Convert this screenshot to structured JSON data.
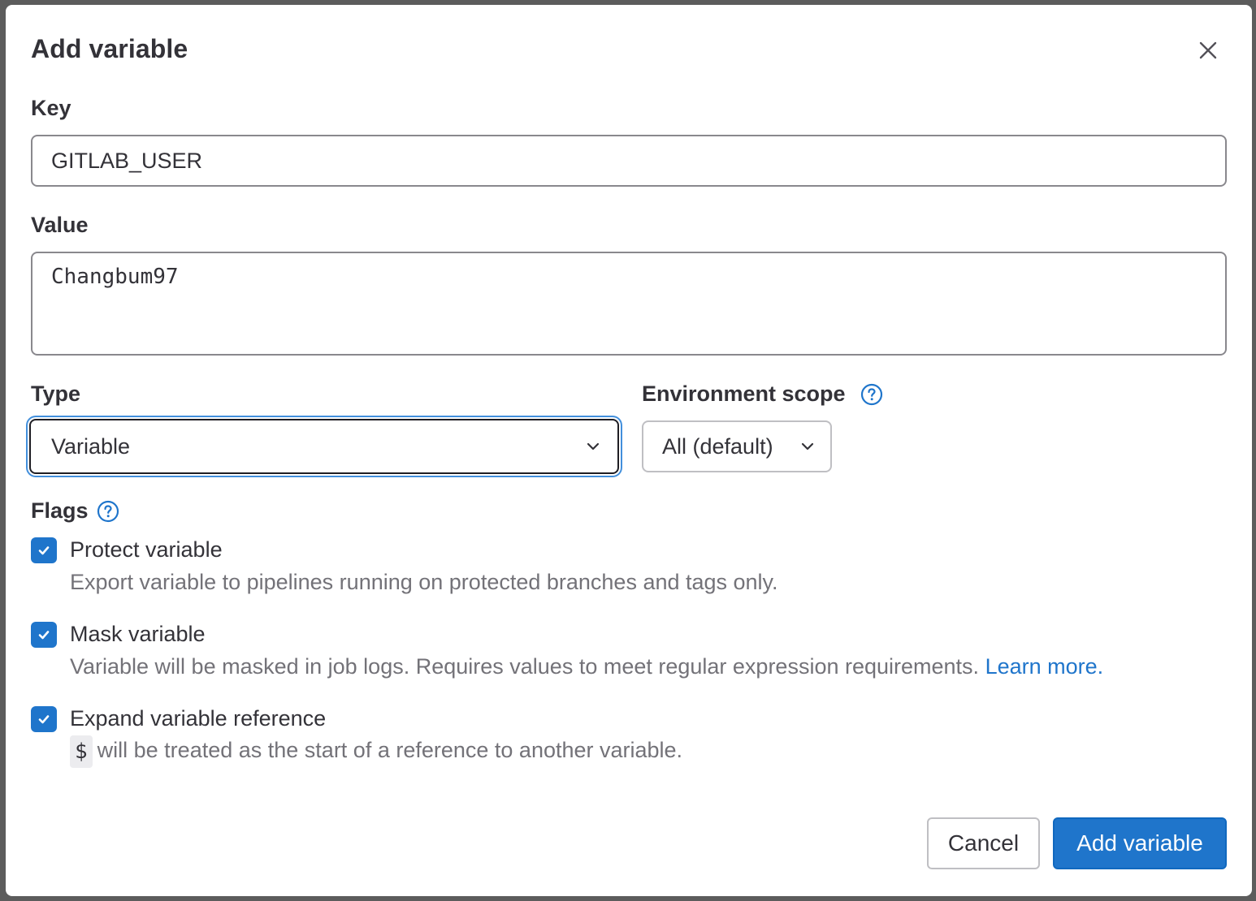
{
  "modal": {
    "title": "Add variable",
    "close_icon": "close-icon"
  },
  "key": {
    "label": "Key",
    "value": "GITLAB_USER"
  },
  "value": {
    "label": "Value",
    "value": "Changbum97"
  },
  "type": {
    "label": "Type",
    "selected": "Variable"
  },
  "environment_scope": {
    "label": "Environment scope",
    "selected": "All (default)"
  },
  "flags": {
    "label": "Flags",
    "items": [
      {
        "label": "Protect variable",
        "checked": true,
        "help": "Export variable to pipelines running on protected branches and tags only."
      },
      {
        "label": "Mask variable",
        "checked": true,
        "help": "Variable will be masked in job logs. Requires values to meet regular expression requirements.",
        "link": "Learn more."
      },
      {
        "label": "Expand variable reference",
        "checked": true,
        "code": "$",
        "help": "will be treated as the start of a reference to another variable."
      }
    ]
  },
  "footer": {
    "cancel_label": "Cancel",
    "submit_label": "Add variable"
  },
  "colors": {
    "primary": "#1f75cb",
    "focus_ring": "#428fdc",
    "help_text": "#737278"
  }
}
